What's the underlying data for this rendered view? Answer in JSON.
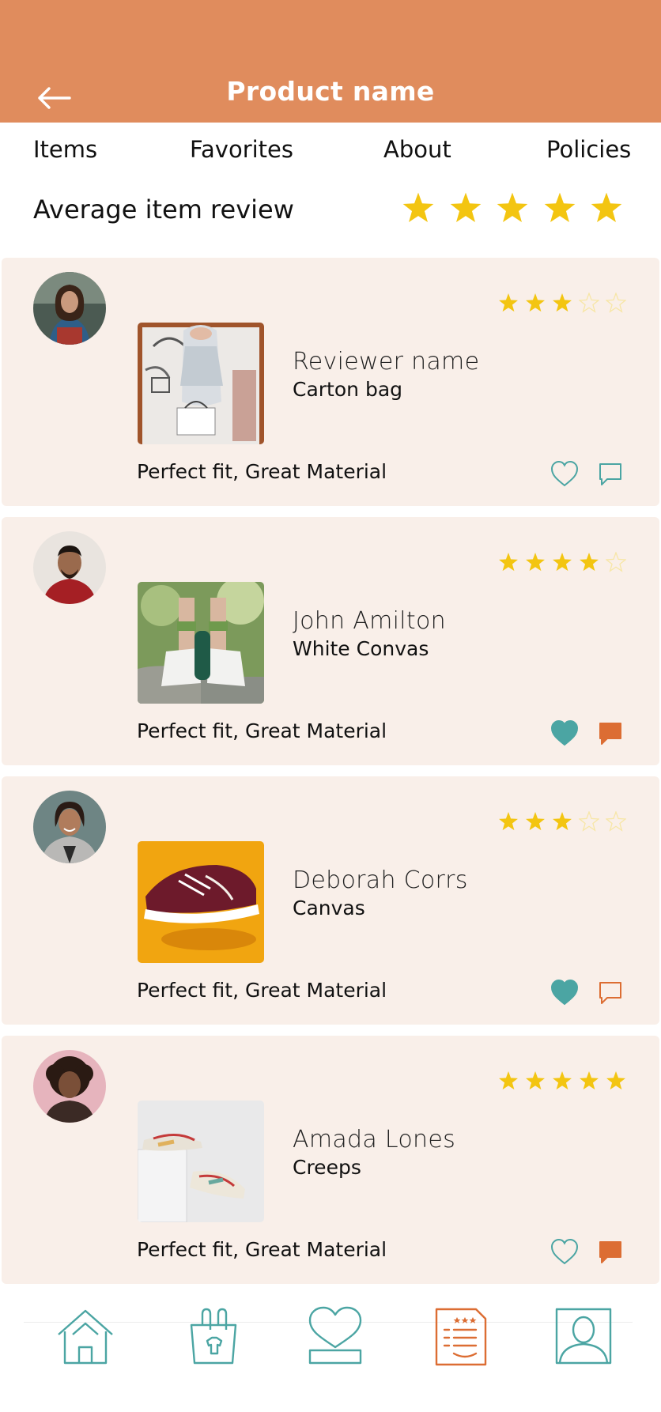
{
  "header": {
    "title": "Product name",
    "back_icon": "back-arrow-icon",
    "background": "#e08c5d"
  },
  "tabs": [
    {
      "label": "Items"
    },
    {
      "label": "Favorites"
    },
    {
      "label": "About"
    },
    {
      "label": "Policies"
    }
  ],
  "average_review": {
    "label": "Average item review",
    "rating": 5,
    "max": 5
  },
  "reviews": [
    {
      "reviewer": "Reviewer name",
      "product": "Carton bag",
      "text": "Perfect fit, Great Material",
      "rating": 3,
      "max": 5,
      "liked": false,
      "commented": false
    },
    {
      "reviewer": "John Amilton",
      "product": "White Convas",
      "text": "Perfect fit, Great Material",
      "rating": 4,
      "max": 5,
      "liked": true,
      "commented": true
    },
    {
      "reviewer": "Deborah Corrs",
      "product": "Canvas",
      "text": "Perfect fit, Great Material",
      "rating": 3,
      "max": 5,
      "liked": true,
      "commented": false
    },
    {
      "reviewer": "Amada Lones",
      "product": "Creeps",
      "text": "Perfect fit, Great Material",
      "rating": 5,
      "max": 5,
      "liked": false,
      "commented": true
    }
  ],
  "bottom_nav": [
    {
      "icon": "home-icon",
      "active": false
    },
    {
      "icon": "shopping-bag-icon",
      "active": false
    },
    {
      "icon": "favorites-heart-icon",
      "active": false
    },
    {
      "icon": "reviews-list-icon",
      "active": true
    },
    {
      "icon": "profile-icon",
      "active": false
    }
  ],
  "colors": {
    "accent": "#e08c5d",
    "card_background": "#f9efe9",
    "star": "#f3c511",
    "star_empty_outline": "#f7e6a6",
    "teal": "#4ba5a3",
    "orange_icon": "#dc6d33"
  }
}
